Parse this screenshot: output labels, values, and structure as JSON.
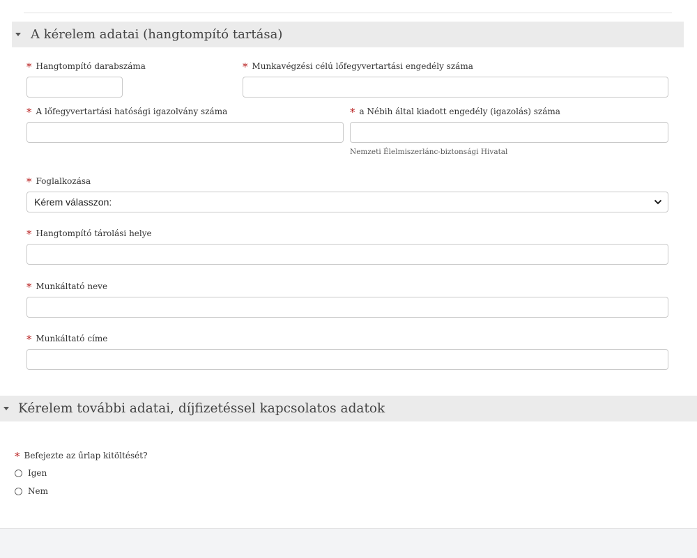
{
  "section1": {
    "title": "A kérelem adatai (hangtompító tartása)",
    "required_mark": "*",
    "fields": {
      "count": {
        "label": "Hangtompító darabszáma",
        "value": ""
      },
      "work_permit": {
        "label": "Munkavégzési célú lőfegyvertartási engedély száma",
        "value": ""
      },
      "authority_id": {
        "label": "A lőfegyvertartási hatósági igazolvány száma",
        "value": ""
      },
      "nebih_permit": {
        "label": "a Nébih által kiadott engedély (igazolás) száma",
        "value": "",
        "hint": "Nemzeti Élelmiszerlánc-biztonsági Hivatal"
      },
      "occupation": {
        "label": "Foglalkozása",
        "selected": "Kérem válasszon:"
      },
      "storage": {
        "label": "Hangtompító tárolási helye",
        "value": ""
      },
      "employer_name": {
        "label": "Munkáltató neve",
        "value": ""
      },
      "employer_address": {
        "label": "Munkáltató címe",
        "value": ""
      }
    }
  },
  "section2": {
    "title": "Kérelem további adatai, díjfizetéssel kapcsolatos adatok",
    "question": "Befejezte az űrlap kitöltését?",
    "options": [
      "Igen",
      "Nem"
    ]
  },
  "icons": {
    "section_toggle": "caret-down-icon",
    "select_arrow": "chevron-down-icon"
  },
  "colors": {
    "required": "#b71c1c",
    "section_bg": "#ebebeb",
    "input_border": "#c9c9c9"
  }
}
